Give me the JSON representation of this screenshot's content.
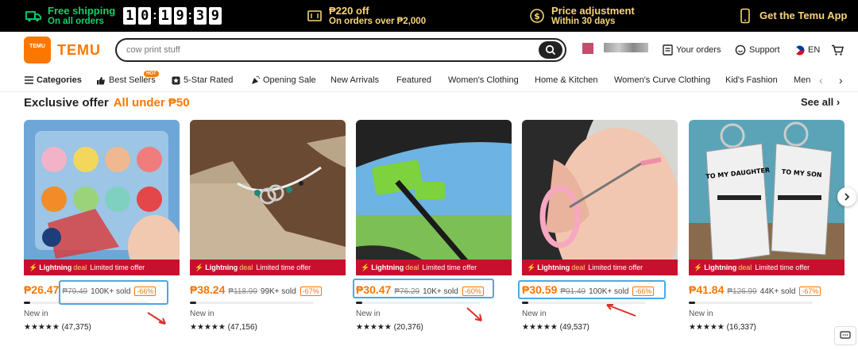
{
  "topbar": {
    "free_shipping_title": "Free shipping",
    "free_shipping_sub": "On all orders",
    "timer": [
      "1",
      "0",
      "1",
      "9",
      "3",
      "9"
    ],
    "discount_title": "₱220 off",
    "discount_sub": "On orders over ₱2,000",
    "price_adj_title": "Price adjustment",
    "price_adj_sub": "Within 30 days",
    "app_label": "Get the Temu App"
  },
  "header": {
    "brand": "TEMU",
    "logo_text": "TEMU",
    "search_value": "cow print stuff",
    "orders": "Your orders",
    "support": "Support",
    "language": "EN"
  },
  "nav": {
    "categories": "Categories",
    "best_sellers": "Best Sellers",
    "hot_badge": "HOT",
    "five_star": "5-Star Rated",
    "opening_sale": "Opening Sale",
    "new_arrivals": "New Arrivals",
    "featured": "Featured",
    "womens_clothing": "Women's Clothing",
    "home_kitchen": "Home & Kitchen",
    "womens_curve": "Women's Curve Clothing",
    "kids_fashion": "Kid's Fashion",
    "men": "Men"
  },
  "section": {
    "title": "Exclusive offer",
    "subtitle": "All under ₱50",
    "see_all": "See all"
  },
  "deal_labels": {
    "lightning": "Lightning",
    "deal": "deal",
    "limited": "Limited time offer"
  },
  "products": [
    {
      "price": "₱26.47",
      "orig": "₱79.49",
      "sold": "100K+ sold",
      "badge": "-66%",
      "new": "New in",
      "stars": "★★★★★",
      "reviews": "(47,375)",
      "progress": 0.05
    },
    {
      "price": "₱38.24",
      "orig": "₱118.99",
      "sold": "99K+ sold",
      "badge": "-67%",
      "new": "New in",
      "stars": "★★★★★",
      "reviews": "(47,156)",
      "progress": 0.05
    },
    {
      "price": "₱30.47",
      "orig": "₱76.29",
      "sold": "10K+ sold",
      "badge": "-60%",
      "new": "New in",
      "stars": "★★★★★",
      "reviews": "(20,376)",
      "progress": 0.05
    },
    {
      "price": "₱30.59",
      "orig": "₱91.49",
      "sold": "100K+ sold",
      "badge": "-66%",
      "new": "New in",
      "stars": "★★★★★",
      "reviews": "(49,537)",
      "progress": 0.05
    },
    {
      "price": "₱41.84",
      "orig": "₱126.99",
      "sold": "44K+ sold",
      "badge": "-67%",
      "new": "New in",
      "stars": "★★★★★",
      "reviews": "(16,337)",
      "progress": 0.05
    }
  ],
  "product_images": [
    {
      "text": ""
    },
    {
      "text": ""
    },
    {
      "text": ""
    },
    {
      "text": ""
    },
    {
      "text_left": "TO MY DAUGHTER",
      "text_right": "TO MY SON"
    }
  ]
}
